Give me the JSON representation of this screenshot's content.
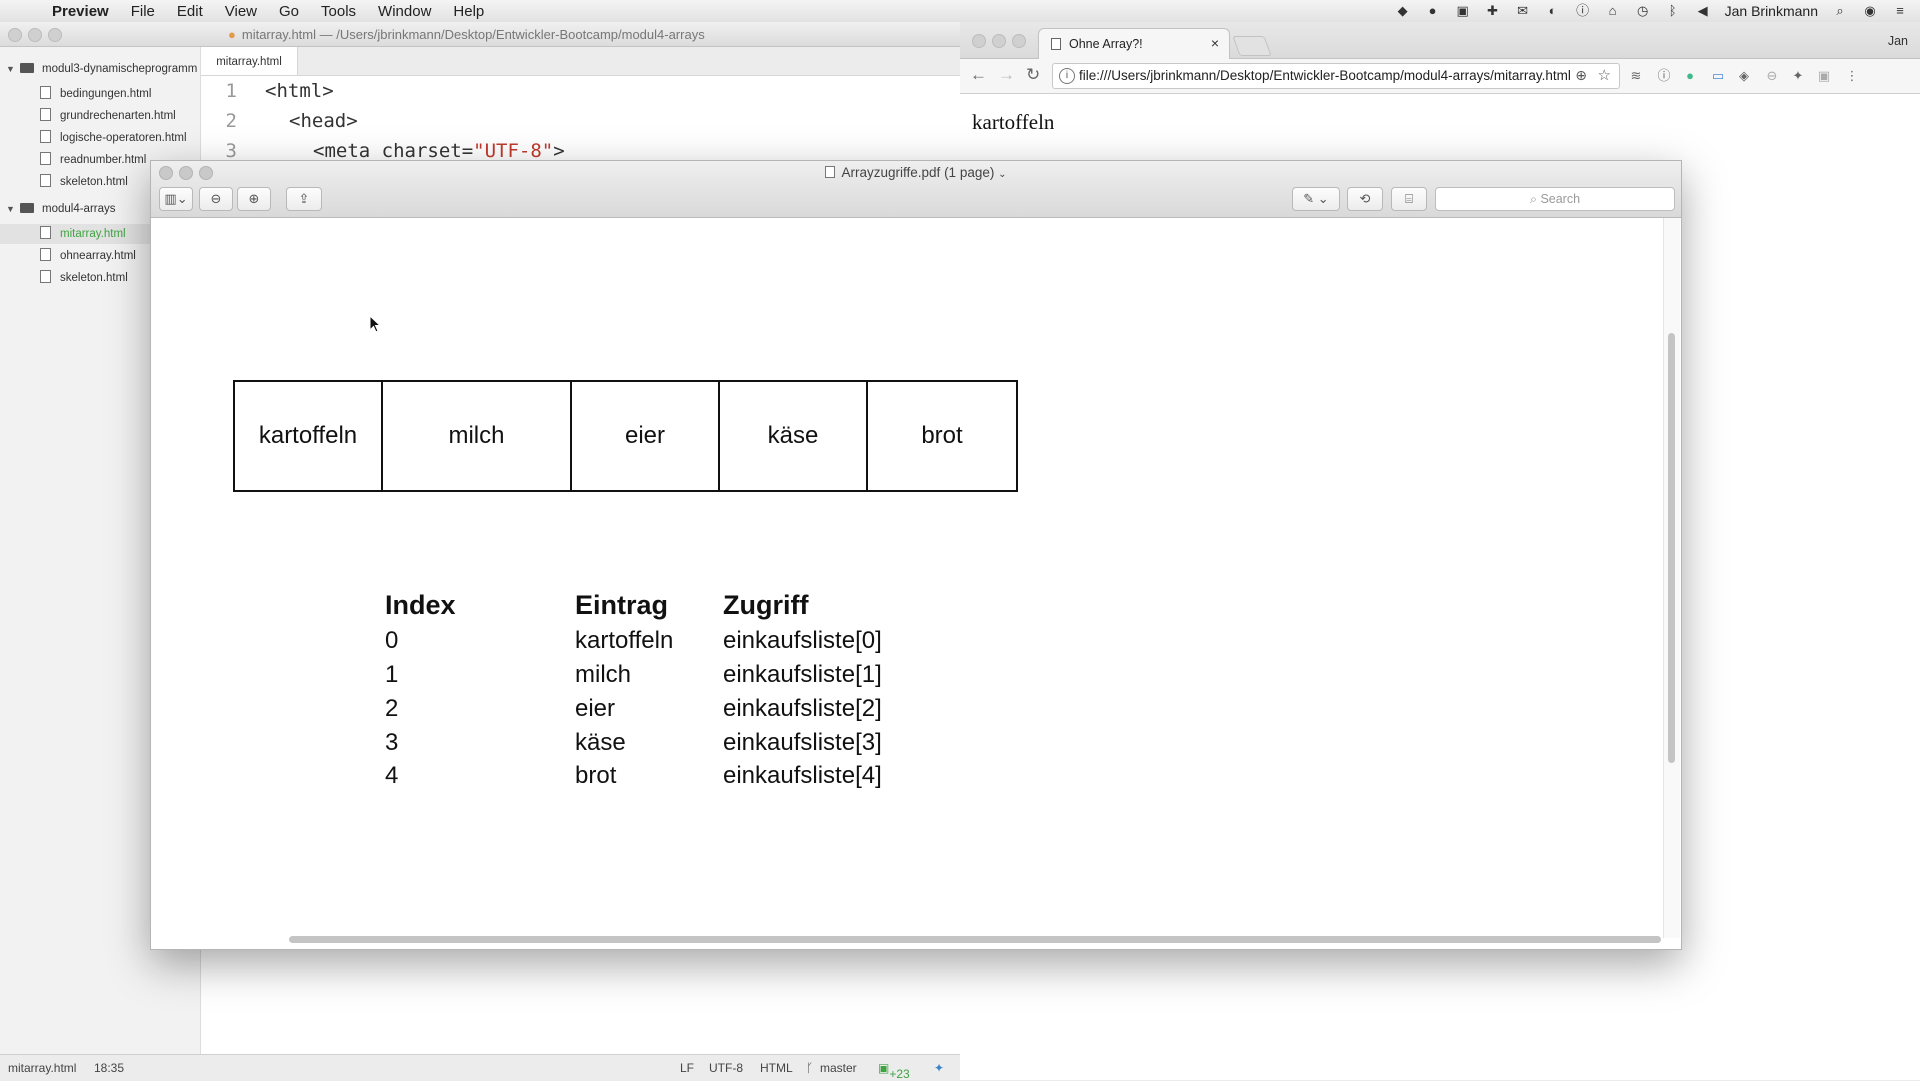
{
  "menubar": {
    "app": "Preview",
    "menus": [
      "File",
      "Edit",
      "View",
      "Go",
      "Tools",
      "Window",
      "Help"
    ],
    "user": "Jan Brinkmann"
  },
  "editor": {
    "title": "mitarray.html — /Users/jbrinkmann/Desktop/Entwickler-Bootcamp/modul4-arrays",
    "tab": "mitarray.html",
    "tree": {
      "folder1": "modul3-dynamischeprogramm",
      "folder1_files": [
        "bedingungen.html",
        "grundrechenarten.html",
        "logische-operatoren.html",
        "readnumber.html",
        "skeleton.html"
      ],
      "folder2": "modul4-arrays",
      "folder2_files": [
        "mitarray.html",
        "ohnearray.html",
        "skeleton.html"
      ]
    },
    "code": {
      "line_numbers": [
        "1",
        "2",
        "3"
      ],
      "line1": "<html>",
      "line2": "<head>",
      "line3_tag": "<meta ",
      "line3_attr": "charset",
      "line3_eq": "=",
      "line3_val": "\"UTF-8\"",
      "line3_end": ">"
    },
    "status": {
      "file": "mitarray.html",
      "pos": "18:35",
      "line_ending": "LF",
      "encoding": "UTF-8",
      "grammar": "HTML",
      "branch": "master",
      "changes": "+23"
    }
  },
  "chrome": {
    "tab_title": "Ohne Array?!",
    "tab_close": "×",
    "profile": "Jan",
    "url": "file:///Users/jbrinkmann/Desktop/Entwickler-Bootcamp/modul4-arrays/mitarray.html",
    "page_text": "kartoffeln"
  },
  "preview": {
    "title": "Arrayzugriffe.pdf",
    "pages": "(1 page)",
    "search_placeholder": "Search",
    "array_cells": [
      "kartoffeln",
      "milch",
      "eier",
      "käse",
      "brot"
    ],
    "table": {
      "headers": [
        "Index",
        "Eintrag",
        "Zugriff"
      ],
      "rows": [
        [
          "0",
          "kartoffeln",
          "einkaufsliste[0]"
        ],
        [
          "1",
          "milch",
          "einkaufsliste[1]"
        ],
        [
          "2",
          "eier",
          "einkaufsliste[2]"
        ],
        [
          "3",
          "käse",
          "einkaufsliste[3]"
        ],
        [
          "4",
          "brot",
          "einkaufsliste[4]"
        ]
      ]
    }
  }
}
